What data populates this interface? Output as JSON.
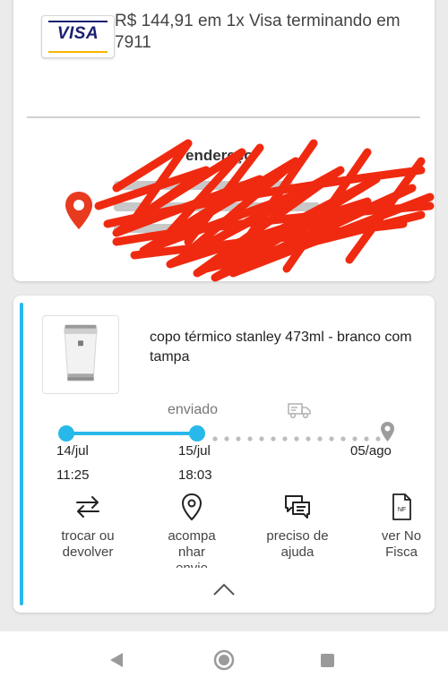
{
  "payment": {
    "card_brand": "VISA",
    "text": "R$ 144,91 em 1x Visa terminando em 7911"
  },
  "address": {
    "title": "endereço",
    "redacted": true
  },
  "item": {
    "title": "copo térmico stanley 473ml - branco com tampa",
    "image_icon": "thermal-cup-image",
    "status": "enviado",
    "timeline": [
      {
        "date": "14/jul",
        "time": "11:25",
        "state": "done"
      },
      {
        "date": "15/jul",
        "time": "18:03",
        "state": "done"
      },
      {
        "date": "05/ago",
        "time": "",
        "state": "pending"
      }
    ],
    "actions": [
      {
        "icon": "swap-arrows-icon",
        "label": "trocar ou\ndevolver"
      },
      {
        "icon": "location-pin-icon",
        "label": "acompa\nnhar\nenvio"
      },
      {
        "icon": "chat-bubbles-icon",
        "label": "preciso de\najuda"
      },
      {
        "icon": "invoice-document-icon",
        "label": "ver No\nFisca",
        "badge": "NF"
      }
    ]
  },
  "colors": {
    "accent": "#28b8e9",
    "scribble": "#f02a10",
    "visa_blue": "#1a1f71",
    "visa_gold": "#f7b600"
  }
}
